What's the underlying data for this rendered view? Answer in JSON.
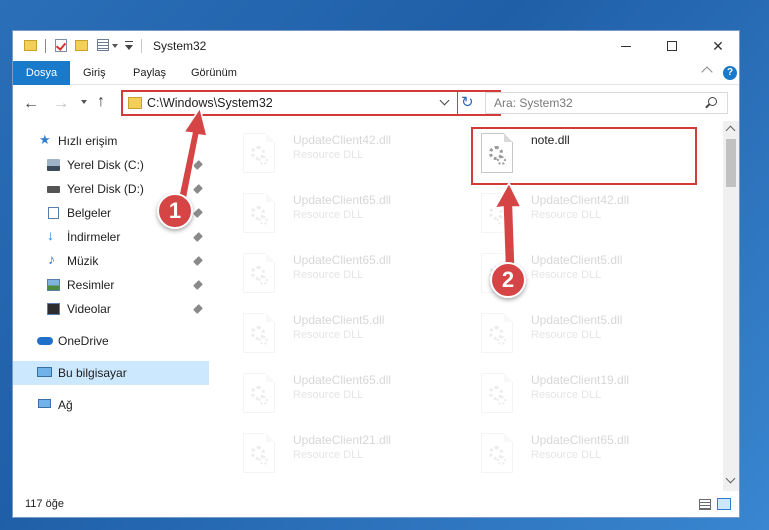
{
  "window": {
    "title": "System32"
  },
  "ribbon": {
    "tabs": [
      {
        "label": "Dosya"
      },
      {
        "label": "Giriş"
      },
      {
        "label": "Paylaş"
      },
      {
        "label": "Görünüm"
      }
    ],
    "help": "?"
  },
  "address": {
    "path": "C:\\Windows\\System32"
  },
  "search": {
    "placeholder": "Ara: System32"
  },
  "sidebar": {
    "items": [
      {
        "label": "Hızlı erişim",
        "icon": "quick-access-star-icon",
        "pinned": false
      },
      {
        "label": "Yerel Disk (C:)",
        "icon": "disk-icon",
        "pinned": true
      },
      {
        "label": "Yerel Disk (D:)",
        "icon": "disk-icon",
        "pinned": true
      },
      {
        "label": "Belgeler",
        "icon": "documents-icon",
        "pinned": true
      },
      {
        "label": "İndirmeler",
        "icon": "downloads-icon",
        "pinned": true
      },
      {
        "label": "Müzik",
        "icon": "music-icon",
        "pinned": true
      },
      {
        "label": "Resimler",
        "icon": "pictures-icon",
        "pinned": true
      },
      {
        "label": "Videolar",
        "icon": "videos-icon",
        "pinned": true
      },
      {
        "label": "OneDrive",
        "icon": "onedrive-icon",
        "pinned": false
      },
      {
        "label": "Bu bilgisayar",
        "icon": "this-pc-icon",
        "pinned": false,
        "selected": true
      },
      {
        "label": "Ağ",
        "icon": "network-icon",
        "pinned": false
      }
    ]
  },
  "files": {
    "left_column": [
      {
        "name": "UpdateClient42.dll",
        "type": "Resource DLL"
      },
      {
        "name": "UpdateClient65.dll",
        "type": "Resource DLL"
      },
      {
        "name": "UpdateClient65.dll",
        "type": "Resource DLL"
      },
      {
        "name": "UpdateClient5.dll",
        "type": "Resource DLL"
      },
      {
        "name": "UpdateClient65.dll",
        "type": "Resource DLL"
      },
      {
        "name": "UpdateClient21.dll",
        "type": "Resource DLL"
      }
    ],
    "right_column": [
      {
        "name": "note.dll",
        "type": "",
        "highlighted": true
      },
      {
        "name": "UpdateClient42.dll",
        "type": "Resource DLL"
      },
      {
        "name": "UpdateClient5.dll",
        "type": "Resource DLL"
      },
      {
        "name": "UpdateClient5.dll",
        "type": "Resource DLL"
      },
      {
        "name": "UpdateClient19.dll",
        "type": "Resource DLL"
      },
      {
        "name": "UpdateClient65.dll",
        "type": "Resource DLL"
      }
    ]
  },
  "status": {
    "item_count": "117 öğe"
  },
  "annotations": {
    "badge1": "1",
    "badge2": "2",
    "color": "#d64545"
  }
}
